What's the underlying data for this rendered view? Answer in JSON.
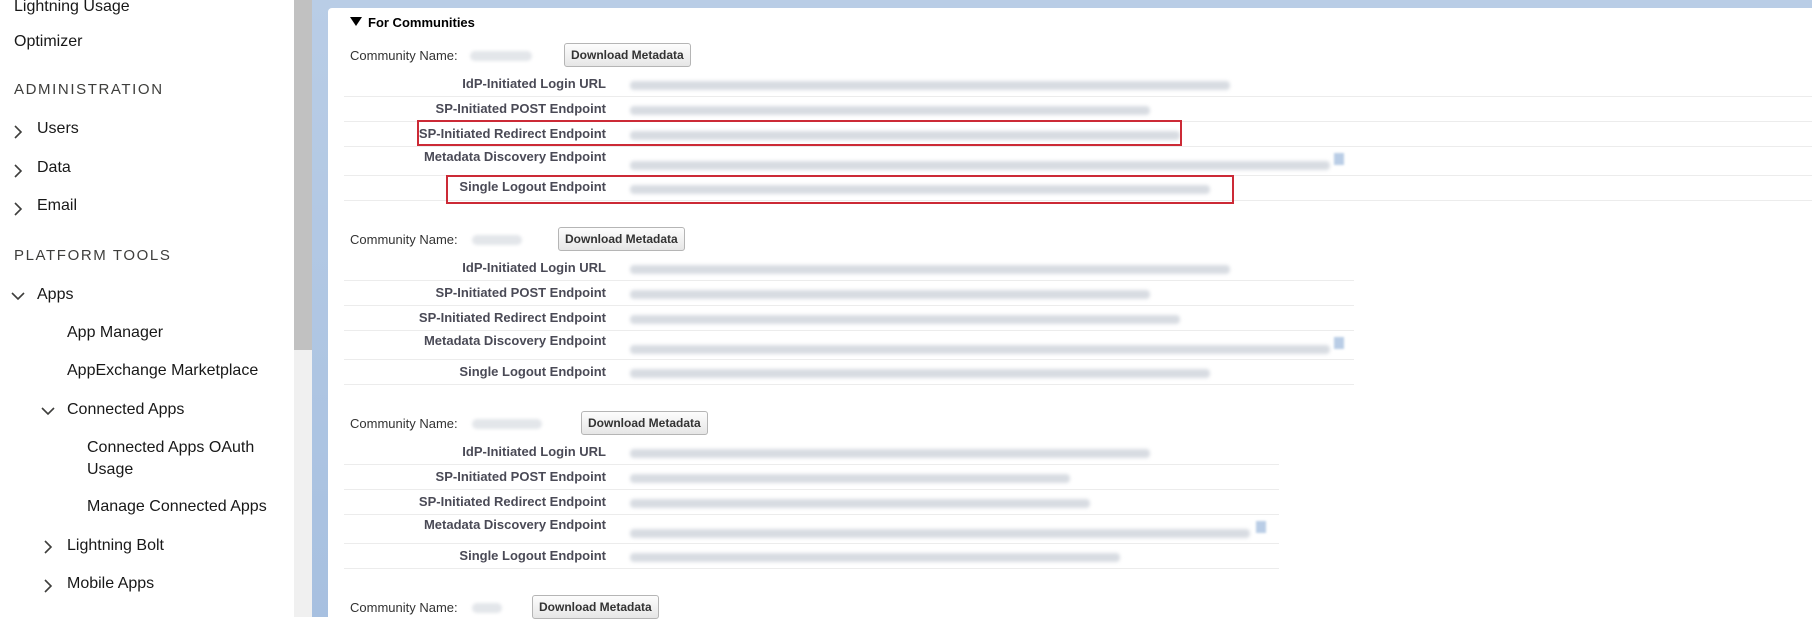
{
  "sidebar": {
    "items": [
      {
        "label": "Lightning Usage"
      },
      {
        "label": "Optimizer"
      },
      {
        "label": "ADMINISTRATION"
      },
      {
        "label": "Users"
      },
      {
        "label": "Data"
      },
      {
        "label": "Email"
      },
      {
        "label": "PLATFORM TOOLS"
      },
      {
        "label": "Apps"
      },
      {
        "label": "App Manager"
      },
      {
        "label": "AppExchange Marketplace"
      },
      {
        "label": "Connected Apps"
      },
      {
        "label": "Connected Apps OAuth"
      },
      {
        "label": "Usage"
      },
      {
        "label": "Manage Connected Apps"
      },
      {
        "label": "Lightning Bolt"
      },
      {
        "label": "Mobile Apps"
      }
    ]
  },
  "section": {
    "title": "For Communities"
  },
  "communities": [
    {
      "name_label": "Community Name:",
      "button": "Download Metadata",
      "rows": [
        {
          "label": "IdP-Initiated Login URL"
        },
        {
          "label": "SP-Initiated POST Endpoint"
        },
        {
          "label": "SP-Initiated Redirect Endpoint"
        },
        {
          "label": "Metadata Discovery Endpoint"
        },
        {
          "label": "Single Logout Endpoint"
        }
      ]
    },
    {
      "name_label": "Community Name:",
      "button": "Download Metadata",
      "rows": [
        {
          "label": "IdP-Initiated Login URL"
        },
        {
          "label": "SP-Initiated POST Endpoint"
        },
        {
          "label": "SP-Initiated Redirect Endpoint"
        },
        {
          "label": "Metadata Discovery Endpoint"
        },
        {
          "label": "Single Logout Endpoint"
        }
      ]
    },
    {
      "name_label": "Community Name:",
      "button": "Download Metadata",
      "rows": [
        {
          "label": "IdP-Initiated Login URL"
        },
        {
          "label": "SP-Initiated POST Endpoint"
        },
        {
          "label": "SP-Initiated Redirect Endpoint"
        },
        {
          "label": "Metadata Discovery Endpoint"
        },
        {
          "label": "Single Logout Endpoint"
        }
      ]
    },
    {
      "name_label": "Community Name:",
      "button": "Download Metadata"
    }
  ],
  "colors": {
    "highlight": "#cc2a36",
    "background_band": "#b9cde6"
  }
}
